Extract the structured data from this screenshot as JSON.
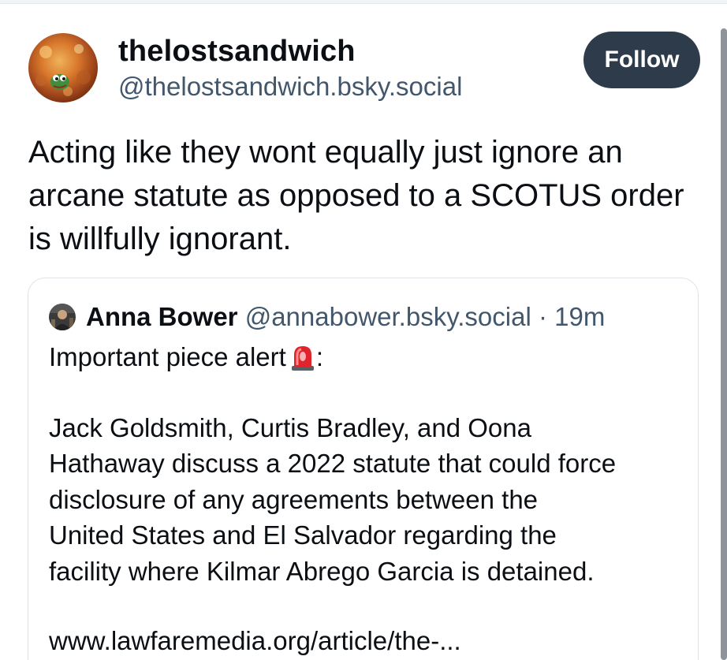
{
  "post": {
    "author": {
      "display_name": "thelostsandwich",
      "handle": "@thelostsandwich.bsky.social",
      "avatar_icon": "frog-avatar-icon"
    },
    "follow_label": "Follow",
    "text": "Acting like they wont equally just ignore an arcane statute as opposed to a SCOTUS order is willfully ignorant."
  },
  "quote": {
    "author": {
      "display_name": "Anna Bower",
      "handle": "@annabower.bsky.social",
      "separator": "·",
      "time": "19m",
      "avatar_icon": "profile-photo-avatar"
    },
    "line1": "Important piece alert",
    "line1_suffix": ":",
    "emoji_icon": "police-siren-icon",
    "paragraph_lines": [
      "Jack Goldsmith, Curtis Bradley, and Oona",
      "Hathaway discuss a 2022 statute that could force",
      "disclosure of any agreements between the",
      "United States and El Salvador regarding the",
      "facility where Kilmar Abrego Garcia is detained."
    ],
    "link_text": "www.lawfaremedia.org/article/the-..."
  },
  "colors": {
    "follow_bg": "#2e3b4b",
    "handle_text": "#42576c",
    "card_border": "#dfe3e8"
  }
}
